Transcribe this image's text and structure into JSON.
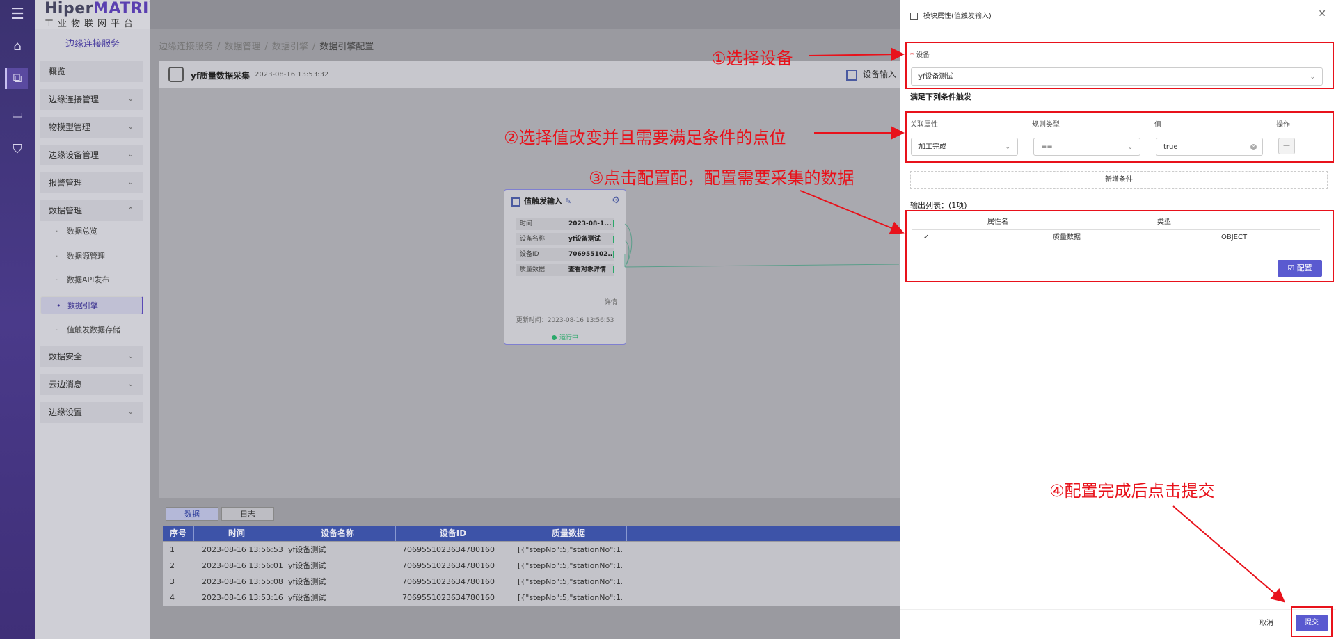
{
  "brand": {
    "name_a": "Hiper",
    "name_b": "MATRIX",
    "subtitle": "工业物联网平台"
  },
  "rail": {
    "icons": [
      "menu-icon",
      "home-icon",
      "connect-icon",
      "monitor-icon",
      "shield-icon"
    ]
  },
  "menu": {
    "service": "边缘连接服务",
    "items": [
      {
        "label": "概览"
      },
      {
        "label": "边缘连接管理"
      },
      {
        "label": "物模型管理"
      },
      {
        "label": "边缘设备管理"
      },
      {
        "label": "报警管理"
      },
      {
        "label": "数据管理"
      }
    ],
    "sub": [
      {
        "label": "数据总览"
      },
      {
        "label": "数据源管理"
      },
      {
        "label": "数据API发布"
      },
      {
        "label": "数据引擎"
      },
      {
        "label": "值触发数据存储"
      }
    ],
    "items2": [
      {
        "label": "数据安全"
      },
      {
        "label": "云边消息"
      },
      {
        "label": "边缘设置"
      }
    ]
  },
  "breadcrumb": [
    "边缘连接服务",
    "数据管理",
    "数据引擎",
    "数据引擎配置"
  ],
  "breadcrumb_sep": "/",
  "titlebar": {
    "name": "yf质量数据采集",
    "timestamp": "2023-08-16 13:53:32",
    "device_input": "设备输入"
  },
  "node": {
    "title": "值触发输入",
    "rows": [
      {
        "k": "时间",
        "v": "2023-08-1..."
      },
      {
        "k": "设备名称",
        "v": "yf设备测试"
      },
      {
        "k": "设备ID",
        "v": "706955102..."
      },
      {
        "k": "质量数据",
        "v": "查看对象详情"
      }
    ],
    "detail": "详情",
    "updated": "更新时间：2023-08-16 13:56:53",
    "status": "运行中"
  },
  "bottom": {
    "tabs": [
      "数据",
      "日志"
    ],
    "columns": [
      "序号",
      "时间",
      "设备名称",
      "设备ID",
      "质量数据"
    ],
    "rows": [
      [
        "1",
        "2023-08-16 13:56:53",
        "yf设备测试",
        "706955102363478016​0",
        "[{\"stepNo\":5,\"stationNo\":1..."
      ],
      [
        "2",
        "2023-08-16 13:56:01",
        "yf设备测试",
        "7069551023634780160",
        "[{\"stepNo\":5,\"stationNo\":1..."
      ],
      [
        "3",
        "2023-08-16 13:55:08",
        "yf设备测试",
        "7069551023634780160",
        "[{\"stepNo\":5,\"stationNo\":1..."
      ],
      [
        "4",
        "2023-08-16 13:53:16",
        "yf设备测试",
        "7069551023634780160",
        "[{\"stepNo\":5,\"stationNo\":1..."
      ]
    ]
  },
  "panel": {
    "title": "模块属性(值触发输入)",
    "device_label": "设备",
    "device_required": "*",
    "device_value": "yf设备测试",
    "conditions_title": "满足下列条件触发",
    "cond_headers": [
      "关联属性",
      "规则类型",
      "值",
      "操作"
    ],
    "cond_row": {
      "attr": "加工完成",
      "rule": "==",
      "value": "true",
      "op": "—"
    },
    "add_condition": "新增条件",
    "output_title": "输出列表：(1项)",
    "output_headers": [
      "属性名",
      "类型"
    ],
    "output_row": {
      "check": "✓",
      "name": "质量数据",
      "type": "OBJECT"
    },
    "config_button": "配置",
    "cancel": "取消",
    "submit": "提交"
  },
  "annotations": {
    "n1": "①选择设备",
    "n2": "②选择值改变并且需要满足条件的点位",
    "n3": "③点击配置配，配置需要采集的数据",
    "n4": "④配置完成后点击提交"
  },
  "colors": {
    "accent": "#5a5ad0",
    "annotation": "#e8121b",
    "rail": "#3b3270",
    "table_header": "#3d53a8"
  }
}
